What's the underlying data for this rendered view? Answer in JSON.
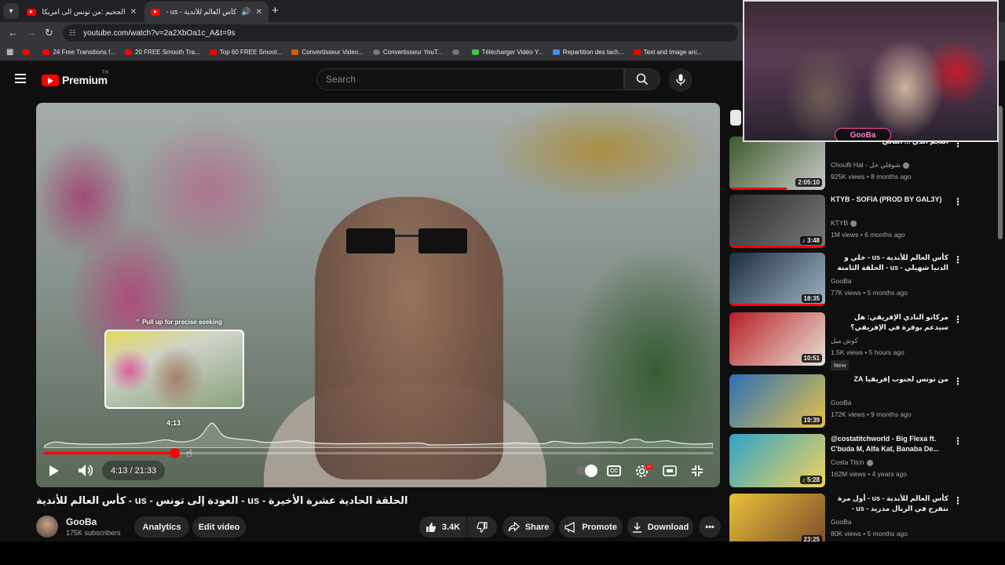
{
  "browser": {
    "tabs": [
      {
        "title": "الجحيم :من تونس الى امريكا أخذتُ"
      },
      {
        "title": "كأس العالم للأندية - us - الع"
      }
    ],
    "url": "youtube.com/watch?v=2a2XbOa1c_A&t=9s",
    "bookmarks": [
      {
        "label": "",
        "icon": "yt"
      },
      {
        "label": "24 Free Transitions f...",
        "icon": "yt"
      },
      {
        "label": "20 FREE Smooth Tra...",
        "icon": "yt"
      },
      {
        "label": "Top 60 FREE Smoot...",
        "icon": "yt"
      },
      {
        "label": "Convertisseur Video...",
        "icon": "z"
      },
      {
        "label": "Convertisseur YouT...",
        "icon": "g"
      },
      {
        "label": "",
        "icon": "g"
      },
      {
        "label": "Télécharger Vidéo Y...",
        "icon": "d"
      },
      {
        "label": "Repartition des tach...",
        "icon": "doc"
      },
      {
        "label": "Text and Image ani...",
        "icon": "yt"
      }
    ]
  },
  "header": {
    "logo_text": "Premium",
    "logo_superscript": "TN",
    "search_placeholder": "Search"
  },
  "player": {
    "preview_hint": "Pull up for precise seeking",
    "preview_time": "4:13",
    "current_time": "4:13",
    "separator": " / ",
    "duration": "21:33",
    "progress": 0.195,
    "hd_badge": "HD"
  },
  "video": {
    "title": "الحلقة الحادية عشرة الأخيرة - us - العودة إلى تونس - us - كأس العالم للأندية",
    "channel": "GooBa",
    "subscribers": "175K subscribers",
    "buttons": {
      "analytics": "Analytics",
      "edit": "Edit video",
      "likes": "3.4K",
      "share": "Share",
      "promote": "Promote",
      "download": "Download"
    }
  },
  "sidebar": {
    "items": [
      {
        "title": "النجم الذي ... التالي",
        "rtl": true,
        "channel": "Choufli Hal - شوفلي حل",
        "verified": true,
        "meta": "925K views • 8 months ago",
        "duration": "2:05:10",
        "short": false,
        "progress": 0.6,
        "new": "",
        "thumb_a": "#3d5a2a",
        "thumb_b": "#c9c9c9"
      },
      {
        "title": "KTYB - SOFIA (PROD BY GAL3Y)",
        "rtl": false,
        "channel": "KTYB",
        "verified": true,
        "meta": "1M views • 6 months ago",
        "duration": "3:48",
        "short": true,
        "progress": 1.0,
        "new": "",
        "thumb_a": "#2b2b2b",
        "thumb_b": "#7a7a7a"
      },
      {
        "title": "كأس العالم للأندية - us - خلي و الدنيا شهيلي - us - الحلقة الثامنة",
        "rtl": true,
        "channel": "GooBa",
        "verified": false,
        "meta": "77K views • 5 months ago",
        "duration": "18:35",
        "short": false,
        "progress": 1.0,
        "new": "",
        "thumb_a": "#1d2e3d",
        "thumb_b": "#9fb3c4"
      },
      {
        "title": "مركاتو النادي الإفريقي: هل سيدعم بوقرة في الإفريقي؟ الشوعبالي ماريوس علو تحت ...",
        "rtl": true,
        "channel": "كوش ميل",
        "verified": false,
        "meta": "1.5K views • 5 hours ago",
        "duration": "10:51",
        "short": false,
        "progress": 0,
        "new": "New",
        "thumb_a": "#b81d24",
        "thumb_b": "#e8e3d6"
      },
      {
        "title": "من تونس لجنوب إفريقيا ZA",
        "rtl": true,
        "channel": "GooBa",
        "verified": false,
        "meta": "172K views • 9 months ago",
        "duration": "19:39",
        "short": false,
        "progress": 0,
        "new": "",
        "thumb_a": "#2b6fb8",
        "thumb_b": "#e6c24a"
      },
      {
        "title": "@costatitchworld - Big Flexa ft. C'buda M, Alfa Kat, Banaba De...",
        "rtl": false,
        "channel": "Costa Titch",
        "verified": true,
        "meta": "162M views • 4 years ago",
        "duration": "5:28",
        "short": true,
        "progress": 0,
        "new": "",
        "thumb_a": "#2fa3c8",
        "thumb_b": "#f2d35a"
      },
      {
        "title": "كأس العالم للأندية - us - أول مرة نتفرج في الريال مدريد - us - الحلقة التاسعة",
        "rtl": true,
        "channel": "GooBa",
        "verified": false,
        "meta": "80K views • 5 months ago",
        "duration": "23:25",
        "short": false,
        "progress": 0,
        "new": "",
        "thumb_a": "#e8c23a",
        "thumb_b": "#7a4a2a"
      }
    ]
  },
  "webcam": {
    "logo": "GooBa"
  },
  "colors": {
    "accent": "#ff0000",
    "background": "#0f0f0f",
    "pill": "#272727"
  }
}
